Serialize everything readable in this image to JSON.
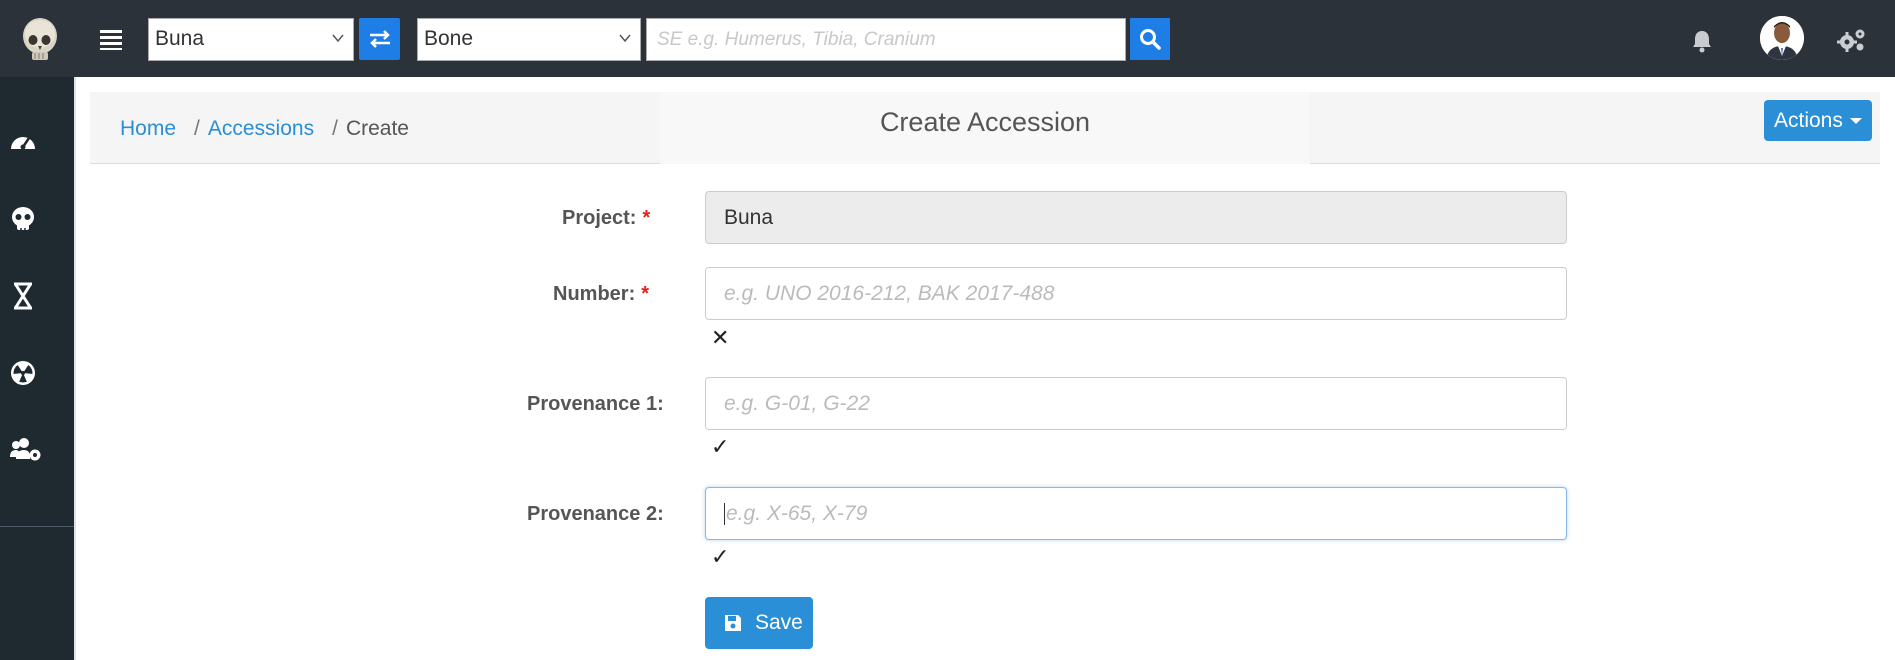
{
  "topbar": {
    "project_select": "Buna",
    "type_select": "Bone",
    "search_placeholder": "SE e.g. Humerus, Tibia, Cranium"
  },
  "breadcrumb": {
    "home": "Home",
    "accessions": "Accessions",
    "current": "Create",
    "sep": "/"
  },
  "page": {
    "title": "Create Accession",
    "actions_label": "Actions"
  },
  "form": {
    "project": {
      "label": "Project:",
      "required_mark": "*",
      "value": "Buna"
    },
    "number": {
      "label": "Number:",
      "required_mark": "*",
      "placeholder": "e.g. UNO 2016-212, BAK 2017-488",
      "status": "✕"
    },
    "provenance1": {
      "label": "Provenance 1:",
      "placeholder": "e.g. G-01, G-22",
      "status": "✓"
    },
    "provenance2": {
      "label": "Provenance 2:",
      "placeholder": "e.g. X-65, X-79",
      "status": "✓"
    },
    "save_label": "Save"
  },
  "icons": {
    "logo": "skull-logo-icon",
    "menu": "hamburger-icon",
    "swap": "swap-icon",
    "search": "search-icon",
    "notifications": "bell-icon",
    "settings": "gears-icon",
    "sidebar": [
      "dashboard-icon",
      "skull-icon",
      "dna-icon",
      "radiation-icon",
      "users-cog-icon"
    ]
  },
  "colors": {
    "topbar": "#2c323a",
    "sidebar": "#1f2a30",
    "accent": "#2a8fd6",
    "search_blue": "#1f7de6",
    "required": "#e02020"
  }
}
